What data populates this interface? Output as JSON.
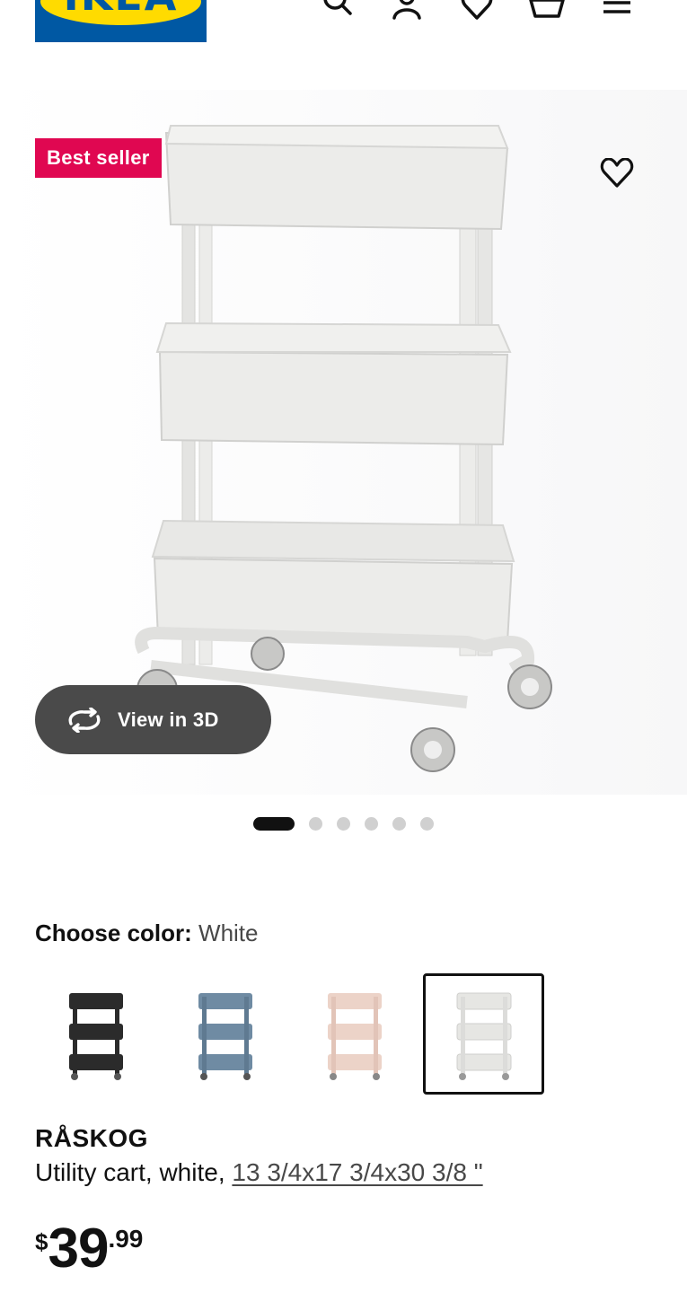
{
  "header": {
    "logo_text": "IKEA",
    "icons": [
      "search-icon",
      "account-icon",
      "favorites-icon",
      "cart-icon",
      "menu-icon"
    ]
  },
  "hero": {
    "badge": "Best seller",
    "view_3d_label": "View in 3D",
    "carousel": {
      "total": 6,
      "active": 1
    }
  },
  "color_chooser": {
    "label": "Choose color:",
    "value": "White",
    "swatches": [
      {
        "name": "Black",
        "color": "#2b2b2b"
      },
      {
        "name": "Blue",
        "color": "#6f8ba3"
      },
      {
        "name": "Pink",
        "color": "#ecd3c8"
      },
      {
        "name": "White",
        "color": "#e6e6e3",
        "selected": true
      }
    ]
  },
  "product": {
    "name": "RÅSKOG",
    "description": "Utility cart, white,",
    "measurements": "13 3/4x17 3/4x30 3/8 \"",
    "price": {
      "currency": "$",
      "integer": "39",
      "decimal": ".99"
    }
  },
  "colors": {
    "badge": "#e00751",
    "brand_blue": "#0058a3",
    "brand_yellow": "#ffdb00",
    "view3d_bg": "#4a4a4a"
  }
}
